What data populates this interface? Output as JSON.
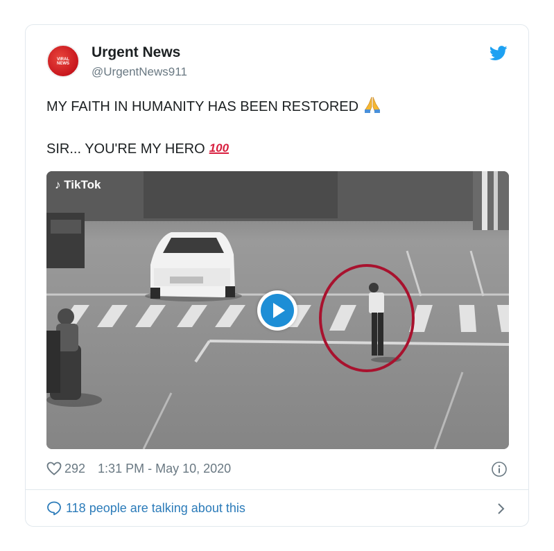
{
  "tweet": {
    "author_name": "Urgent News",
    "author_handle": "@UrgentNews911",
    "avatar_text": "VIRAL NEWS",
    "text_line1": "MY FAITH IN HUMANITY HAS BEEN RESTORED",
    "text_line2": "SIR... YOU'RE MY HERO",
    "emoji1": "pray-emoji",
    "emoji2_text": "100",
    "media": {
      "watermark": "TikTok",
      "play_icon": "play-icon"
    },
    "likes": "292",
    "timestamp": "1:31 PM - May 10, 2020",
    "conversation_label": "118 people are talking about this"
  },
  "colors": {
    "twitter_blue": "#1da1f2",
    "link_blue": "#2b7bb9",
    "muted": "#697882",
    "circle_highlight": "#a8122e"
  },
  "icons": [
    "twitter-bird-icon",
    "heart-icon",
    "info-icon",
    "speech-bubble-icon",
    "chevron-right-icon",
    "play-icon"
  ]
}
